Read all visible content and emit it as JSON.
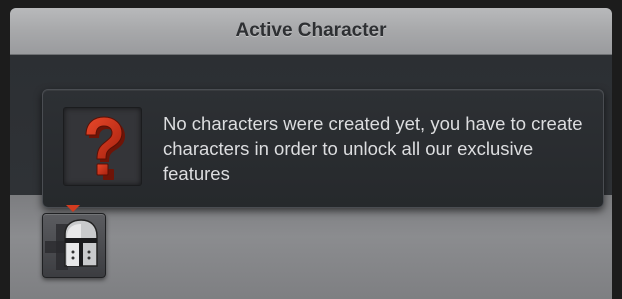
{
  "panel": {
    "title": "Active Character"
  },
  "tooltip": {
    "icon": "question-mark-icon",
    "message": "No characters were created yet, you have to create characters in order to unlock all our exclusive features"
  },
  "character_slot": {
    "icon": "knight-helmet-icon",
    "indicator": "red-arrow-indicator"
  },
  "colors": {
    "header": "#a7a8aa",
    "body": "#2c2f33",
    "accent_red": "#d23b1f",
    "text": "#dcdddf"
  }
}
